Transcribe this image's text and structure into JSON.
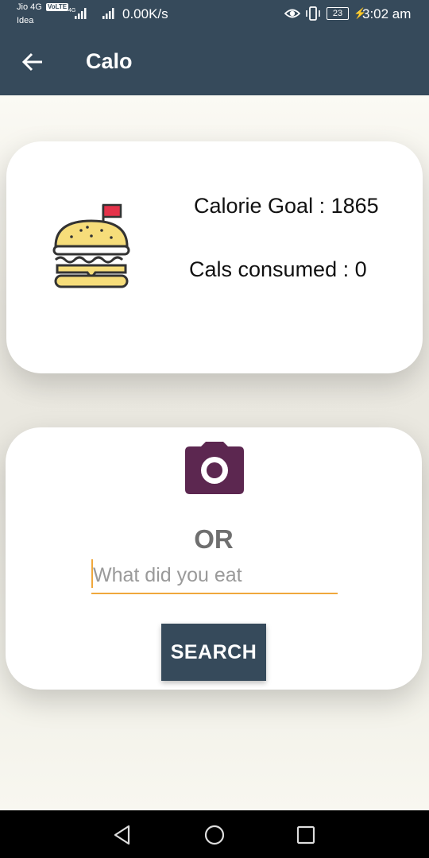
{
  "status_bar": {
    "carrier_1": "Jio 4G",
    "volte_badge": "VoLTE",
    "carrier_2": "Idea",
    "network_speed": "0.00K/s",
    "battery_level": "23",
    "time": "3:02 am",
    "icons": [
      "signal-icon",
      "signal-icon",
      "eye-icon",
      "vibrate-icon",
      "battery-icon",
      "charging-icon"
    ]
  },
  "app_bar": {
    "title": "Calo",
    "back_icon": "arrow-left-icon"
  },
  "goal_card": {
    "icon": "burger-icon",
    "calorie_goal_text": "Calorie Goal : 1865",
    "calories_consumed_text": "Cals consumed : 0"
  },
  "search_card": {
    "camera_icon": "camera-icon",
    "or_label": "OR",
    "input_placeholder": "What did you eat",
    "input_value": "",
    "search_button_label": "SEARCH",
    "accent_color": "#f0a83c",
    "camera_color": "#5c2750"
  },
  "colors": {
    "primary": "#364a5b",
    "background": "#f6f4ec"
  },
  "nav_bar": {
    "icons": [
      "nav-back-icon",
      "nav-home-icon",
      "nav-recents-icon"
    ]
  }
}
